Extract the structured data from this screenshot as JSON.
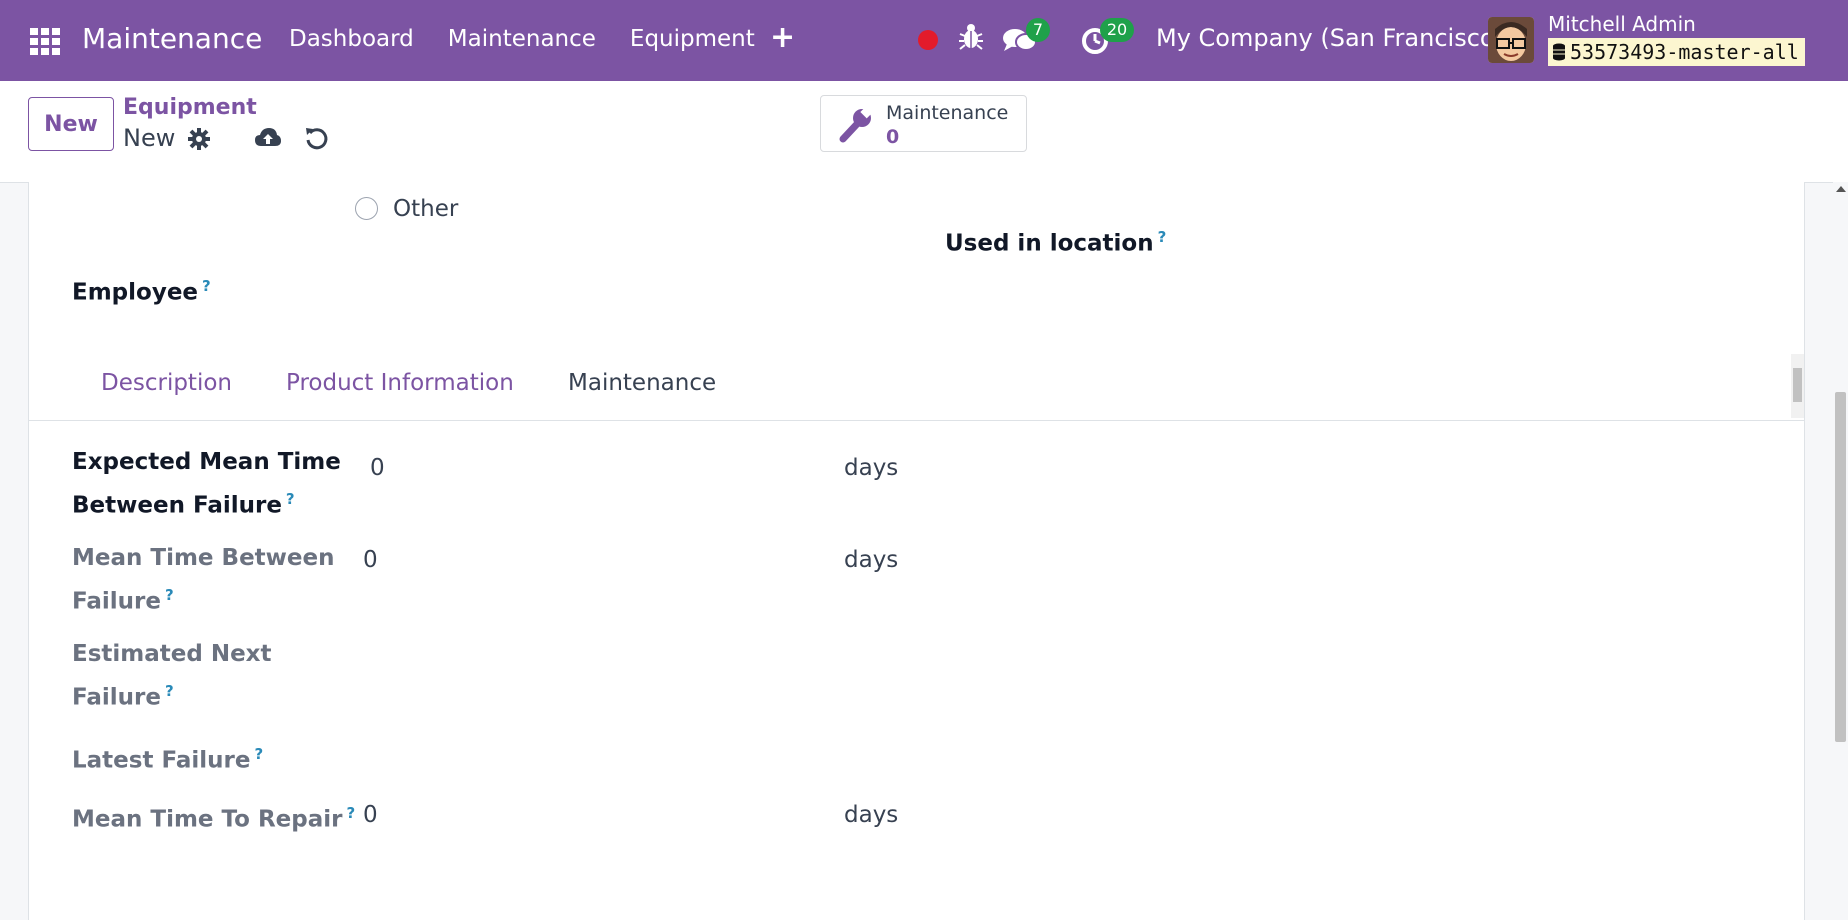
{
  "navbar": {
    "app_name": "Maintenance",
    "menu": [
      "Dashboard",
      "Maintenance",
      "Equipment"
    ],
    "plus": "+",
    "chat_count": "7",
    "activity_count": "20",
    "company": "My Company (San Francisco)",
    "user_name": "Mitchell Admin",
    "db_name": "53573493-master-all",
    "colors": {
      "navbar": "#7c54a3",
      "badge": "#1fa14a",
      "record": "#e31b2b"
    }
  },
  "control": {
    "new_label": "New",
    "breadcrumb_parent": "Equipment",
    "breadcrumb_current": "New",
    "smart_button": {
      "label": "Maintenance",
      "value": "0"
    }
  },
  "form": {
    "radio_other": "Other",
    "used_in_location": "Used in location",
    "employee": "Employee",
    "tooltip_mark": "?"
  },
  "tabs": [
    "Description",
    "Product Information",
    "Maintenance"
  ],
  "active_tab": "Maintenance",
  "maintenance_fields": {
    "mtbf_expected": {
      "label_line1": "Expected Mean Time",
      "label_line2": "Between Failure",
      "value": "0",
      "unit": "days"
    },
    "mtbf": {
      "label_line1": "Mean Time Between",
      "label_line2": "Failure",
      "value": "0",
      "unit": "days"
    },
    "estimated_next": {
      "label_line1": "Estimated Next",
      "label_line2": "Failure"
    },
    "latest_failure": {
      "label": "Latest Failure"
    },
    "mttr": {
      "label": "Mean Time To Repair",
      "value": "0",
      "unit": "days"
    }
  }
}
